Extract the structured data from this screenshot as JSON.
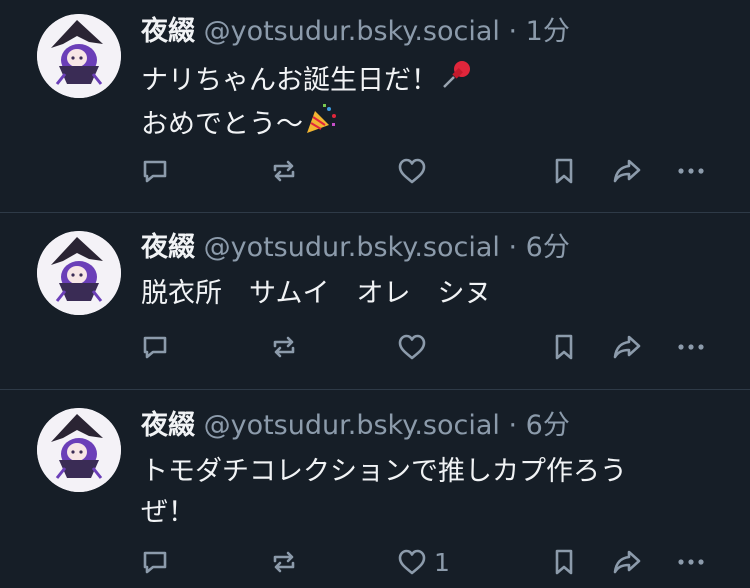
{
  "posts": [
    {
      "author": {
        "display_name": "夜綴",
        "handle": "@yotsudur.bsky.social"
      },
      "separator": "·",
      "time": "1分",
      "lines": [
        "ナリちゃんお誕生日だ！",
        "おめでとう〜"
      ],
      "emojis": [
        "pushpin-emoji",
        "party-popper-emoji"
      ],
      "like_count": ""
    },
    {
      "author": {
        "display_name": "夜綴",
        "handle": "@yotsudur.bsky.social"
      },
      "separator": "·",
      "time": "6分",
      "lines": [
        "脱衣所　サムイ　オレ　シヌ"
      ],
      "like_count": ""
    },
    {
      "author": {
        "display_name": "夜綴",
        "handle": "@yotsudur.bsky.social"
      },
      "separator": "·",
      "time": "6分",
      "lines": [
        "トモダチコレクションで推しカプ作ろう",
        "ぜ！"
      ],
      "like_count": "1"
    }
  ],
  "icons": [
    "reply-icon",
    "repost-icon",
    "like-icon",
    "bookmark-icon",
    "share-icon",
    "more-icon"
  ],
  "colors": {
    "background": "#161e27",
    "text": "#f1f3f5",
    "muted": "#8c9bab",
    "divider": "#2e3a47",
    "avatar_accent": "#6b3fb8"
  }
}
